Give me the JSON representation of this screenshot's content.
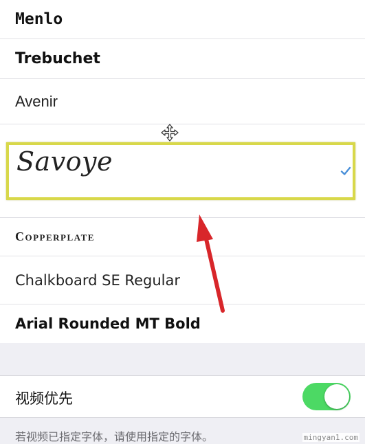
{
  "font_list": {
    "items": [
      {
        "label": "Menlo",
        "selected": false
      },
      {
        "label": "Trebuchet",
        "selected": false
      },
      {
        "label": "Avenir",
        "selected": false
      },
      {
        "label": "Savoye",
        "selected": true
      },
      {
        "label": "Copperplate",
        "selected": false
      },
      {
        "label": "Chalkboard SE Regular",
        "selected": false
      },
      {
        "label": "Arial Rounded MT Bold",
        "selected": false
      }
    ]
  },
  "settings": {
    "video_priority_label": "视频优先",
    "video_priority_on": true,
    "footer_note": "若视频已指定字体，请使用指定的字体。"
  },
  "colors": {
    "checkmark": "#4a90d9",
    "toggle_on": "#4cd964",
    "highlight_box": "#d8d84a",
    "annotation_arrow": "#d8262a",
    "group_background": "#efeff4"
  },
  "icons": {
    "selected_indicator": "checkmark-icon",
    "cursor": "move-cursor-icon",
    "annotation": "red-arrow-icon"
  },
  "watermark": "mingyan1.com"
}
